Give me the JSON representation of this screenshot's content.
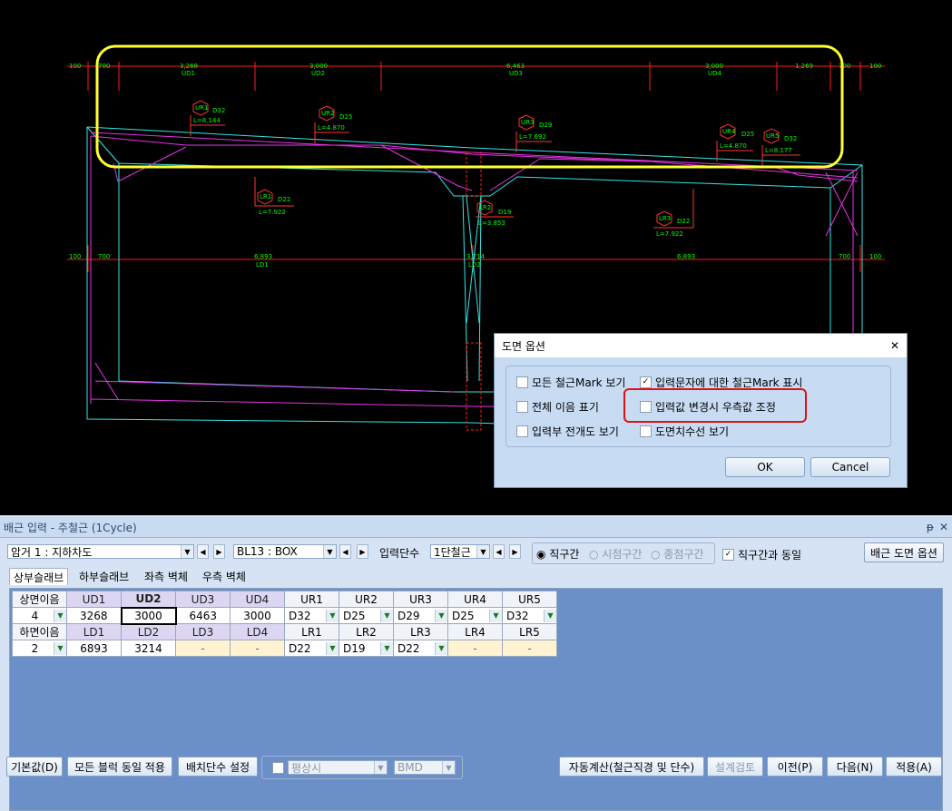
{
  "drawing": {
    "dimensions_top": [
      "100",
      "700",
      "3,268",
      "3,000",
      "6,463",
      "3,000",
      "1,269",
      "700",
      "100"
    ],
    "dimension_labels_top": [
      "UD1",
      "UD2",
      "UD3",
      "UD4"
    ],
    "dimensions_mid": [
      "100",
      "700",
      "6,893",
      "3,214",
      "6,893",
      "700",
      "100"
    ],
    "dimension_labels_mid": [
      "LD1",
      "LD2"
    ],
    "marks": [
      {
        "mark": "UR1",
        "bar": "D32",
        "len": "L=8.144"
      },
      {
        "mark": "UR2",
        "bar": "D25",
        "len": "L=4.870"
      },
      {
        "mark": "UR3",
        "bar": "D29",
        "len": "L=7.692"
      },
      {
        "mark": "UR4",
        "bar": "D25",
        "len": "L=4.870"
      },
      {
        "mark": "UR5",
        "bar": "D32",
        "len": "L=8.177"
      },
      {
        "mark": "LR1",
        "bar": "D22",
        "len": "L=7.922"
      },
      {
        "mark": "LR2",
        "bar": "D19",
        "len": "L=3.853"
      },
      {
        "mark": "LR3",
        "bar": "D22",
        "len": "L=7.922"
      }
    ]
  },
  "dialog": {
    "title": "도면 옵션",
    "close": "✕",
    "options": [
      {
        "label": "모든 철근Mark 보기",
        "checked": false
      },
      {
        "label": "입력문자에 대한 철근Mark 표시",
        "checked": true
      },
      {
        "label": "전체 이음 표기",
        "checked": false
      },
      {
        "label": "입력값 변경시 우측값 조정",
        "checked": false
      },
      {
        "label": "입력부 전개도 보기",
        "checked": false
      },
      {
        "label": "도면치수선 보기",
        "checked": false
      }
    ],
    "ok": "OK",
    "cancel": "Cancel"
  },
  "panel": {
    "title": "배근 입력 - 주철근 (1Cycle)",
    "pin": "ᵽ",
    "close": "✕",
    "culvert_select": "암거 1 : 지하차도",
    "block_select": "BL13 : BOX",
    "input_level_label": "입력단수",
    "input_level_select": "1단철근",
    "radios": [
      "직구간",
      "시점구간",
      "종점구간"
    ],
    "same_as_straight": "직구간과 동일",
    "drawing_options_button": "배근 도면 옵션",
    "tabs": [
      "상부슬래브",
      "하부슬래브",
      "좌측 벽체",
      "우측 벽체"
    ],
    "grid": {
      "top_header": [
        "상면이음",
        "UD1",
        "UD2",
        "UD3",
        "UD4",
        "UR1",
        "UR2",
        "UR3",
        "UR4",
        "UR5"
      ],
      "top_values": [
        "4",
        "3268",
        "3000",
        "6463",
        "3000",
        "D32",
        "D25",
        "D29",
        "D25",
        "D32"
      ],
      "bottom_header": [
        "하면이음",
        "LD1",
        "LD2",
        "LD3",
        "LD4",
        "LR1",
        "LR2",
        "LR3",
        "LR4",
        "LR5"
      ],
      "bottom_values": [
        "2",
        "6893",
        "3214",
        "-",
        "-",
        "D22",
        "D19",
        "D22",
        "-",
        "-"
      ]
    },
    "buttons": {
      "default": "기본값(D)",
      "apply_all": "모든 블럭 동일 적용",
      "layout_levels": "배치단수 설정",
      "normal": "평상시",
      "bmd": "BMD",
      "auto_calc": "자동계산(철근직경 및 단수)",
      "design_check": "설계검토",
      "prev": "이전(P)",
      "next": "다음(N)",
      "apply": "적용(A)"
    }
  },
  "colors": {
    "cad_background": "#000000",
    "dimension_line": "#ff1a1a",
    "outline_cyan": "#33e6e6",
    "rebar_magenta": "#e633e6",
    "highlight_yellow": "#ffff33",
    "highlight_red": "#e01010"
  }
}
